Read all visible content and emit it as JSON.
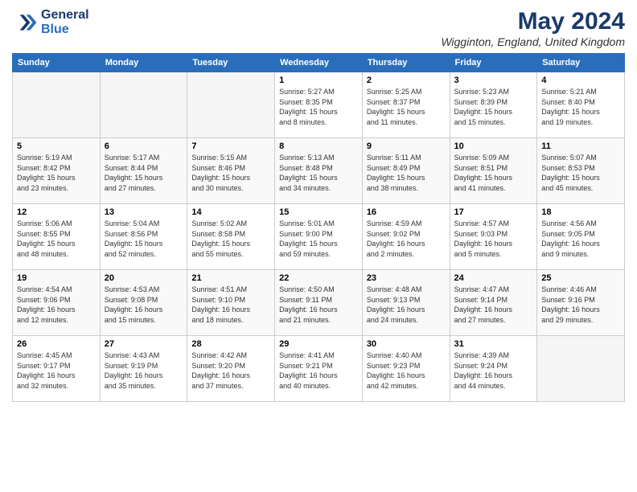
{
  "header": {
    "logo_line1": "General",
    "logo_line2": "Blue",
    "title": "May 2024",
    "subtitle": "Wigginton, England, United Kingdom"
  },
  "columns": [
    "Sunday",
    "Monday",
    "Tuesday",
    "Wednesday",
    "Thursday",
    "Friday",
    "Saturday"
  ],
  "weeks": [
    [
      {
        "day": "",
        "info": ""
      },
      {
        "day": "",
        "info": ""
      },
      {
        "day": "",
        "info": ""
      },
      {
        "day": "1",
        "info": "Sunrise: 5:27 AM\nSunset: 8:35 PM\nDaylight: 15 hours\nand 8 minutes."
      },
      {
        "day": "2",
        "info": "Sunrise: 5:25 AM\nSunset: 8:37 PM\nDaylight: 15 hours\nand 11 minutes."
      },
      {
        "day": "3",
        "info": "Sunrise: 5:23 AM\nSunset: 8:39 PM\nDaylight: 15 hours\nand 15 minutes."
      },
      {
        "day": "4",
        "info": "Sunrise: 5:21 AM\nSunset: 8:40 PM\nDaylight: 15 hours\nand 19 minutes."
      }
    ],
    [
      {
        "day": "5",
        "info": "Sunrise: 5:19 AM\nSunset: 8:42 PM\nDaylight: 15 hours\nand 23 minutes."
      },
      {
        "day": "6",
        "info": "Sunrise: 5:17 AM\nSunset: 8:44 PM\nDaylight: 15 hours\nand 27 minutes."
      },
      {
        "day": "7",
        "info": "Sunrise: 5:15 AM\nSunset: 8:46 PM\nDaylight: 15 hours\nand 30 minutes."
      },
      {
        "day": "8",
        "info": "Sunrise: 5:13 AM\nSunset: 8:48 PM\nDaylight: 15 hours\nand 34 minutes."
      },
      {
        "day": "9",
        "info": "Sunrise: 5:11 AM\nSunset: 8:49 PM\nDaylight: 15 hours\nand 38 minutes."
      },
      {
        "day": "10",
        "info": "Sunrise: 5:09 AM\nSunset: 8:51 PM\nDaylight: 15 hours\nand 41 minutes."
      },
      {
        "day": "11",
        "info": "Sunrise: 5:07 AM\nSunset: 8:53 PM\nDaylight: 15 hours\nand 45 minutes."
      }
    ],
    [
      {
        "day": "12",
        "info": "Sunrise: 5:06 AM\nSunset: 8:55 PM\nDaylight: 15 hours\nand 48 minutes."
      },
      {
        "day": "13",
        "info": "Sunrise: 5:04 AM\nSunset: 8:56 PM\nDaylight: 15 hours\nand 52 minutes."
      },
      {
        "day": "14",
        "info": "Sunrise: 5:02 AM\nSunset: 8:58 PM\nDaylight: 15 hours\nand 55 minutes."
      },
      {
        "day": "15",
        "info": "Sunrise: 5:01 AM\nSunset: 9:00 PM\nDaylight: 15 hours\nand 59 minutes."
      },
      {
        "day": "16",
        "info": "Sunrise: 4:59 AM\nSunset: 9:02 PM\nDaylight: 16 hours\nand 2 minutes."
      },
      {
        "day": "17",
        "info": "Sunrise: 4:57 AM\nSunset: 9:03 PM\nDaylight: 16 hours\nand 5 minutes."
      },
      {
        "day": "18",
        "info": "Sunrise: 4:56 AM\nSunset: 9:05 PM\nDaylight: 16 hours\nand 9 minutes."
      }
    ],
    [
      {
        "day": "19",
        "info": "Sunrise: 4:54 AM\nSunset: 9:06 PM\nDaylight: 16 hours\nand 12 minutes."
      },
      {
        "day": "20",
        "info": "Sunrise: 4:53 AM\nSunset: 9:08 PM\nDaylight: 16 hours\nand 15 minutes."
      },
      {
        "day": "21",
        "info": "Sunrise: 4:51 AM\nSunset: 9:10 PM\nDaylight: 16 hours\nand 18 minutes."
      },
      {
        "day": "22",
        "info": "Sunrise: 4:50 AM\nSunset: 9:11 PM\nDaylight: 16 hours\nand 21 minutes."
      },
      {
        "day": "23",
        "info": "Sunrise: 4:48 AM\nSunset: 9:13 PM\nDaylight: 16 hours\nand 24 minutes."
      },
      {
        "day": "24",
        "info": "Sunrise: 4:47 AM\nSunset: 9:14 PM\nDaylight: 16 hours\nand 27 minutes."
      },
      {
        "day": "25",
        "info": "Sunrise: 4:46 AM\nSunset: 9:16 PM\nDaylight: 16 hours\nand 29 minutes."
      }
    ],
    [
      {
        "day": "26",
        "info": "Sunrise: 4:45 AM\nSunset: 9:17 PM\nDaylight: 16 hours\nand 32 minutes."
      },
      {
        "day": "27",
        "info": "Sunrise: 4:43 AM\nSunset: 9:19 PM\nDaylight: 16 hours\nand 35 minutes."
      },
      {
        "day": "28",
        "info": "Sunrise: 4:42 AM\nSunset: 9:20 PM\nDaylight: 16 hours\nand 37 minutes."
      },
      {
        "day": "29",
        "info": "Sunrise: 4:41 AM\nSunset: 9:21 PM\nDaylight: 16 hours\nand 40 minutes."
      },
      {
        "day": "30",
        "info": "Sunrise: 4:40 AM\nSunset: 9:23 PM\nDaylight: 16 hours\nand 42 minutes."
      },
      {
        "day": "31",
        "info": "Sunrise: 4:39 AM\nSunset: 9:24 PM\nDaylight: 16 hours\nand 44 minutes."
      },
      {
        "day": "",
        "info": ""
      }
    ]
  ]
}
